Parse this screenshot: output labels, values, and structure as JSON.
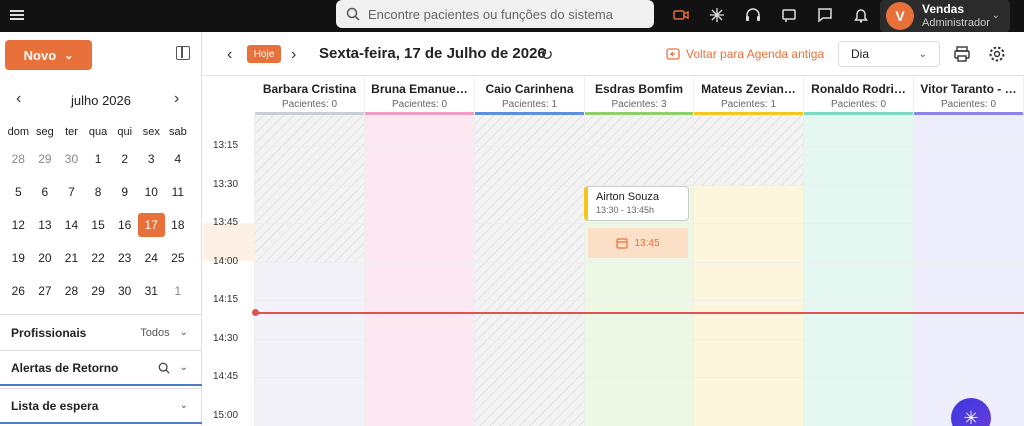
{
  "topbar": {
    "search_placeholder": "Encontre pacientes ou funções do sistema",
    "icons": [
      "video-icon",
      "sparkle-icon",
      "headset-icon",
      "announce-icon",
      "chat-icon",
      "bell-icon"
    ],
    "user": {
      "initial": "V",
      "name": "Vendas",
      "role": "Administrador"
    }
  },
  "sidebar": {
    "new_button": "Novo",
    "calendar": {
      "month_label": "julho 2026",
      "weekdays": [
        "dom",
        "seg",
        "ter",
        "qua",
        "qui",
        "sex",
        "sab"
      ],
      "weeks": [
        [
          "28",
          "29",
          "30",
          "1",
          "2",
          "3",
          "4"
        ],
        [
          "5",
          "6",
          "7",
          "8",
          "9",
          "10",
          "11"
        ],
        [
          "12",
          "13",
          "14",
          "15",
          "16",
          "17",
          "18"
        ],
        [
          "19",
          "20",
          "21",
          "22",
          "23",
          "24",
          "25"
        ],
        [
          "26",
          "27",
          "28",
          "29",
          "30",
          "31",
          "1"
        ]
      ],
      "selected": "17"
    },
    "sections": {
      "profissionais": {
        "label": "Profissionais",
        "value": "Todos"
      },
      "alertas": {
        "label": "Alertas de Retorno"
      },
      "espera": {
        "label": "Lista de espera"
      }
    }
  },
  "toolbar": {
    "today_label": "Hoje",
    "date_label": "Sexta-feira, 17 de Julho de 2026",
    "back_link": "Voltar para Agenda antiga",
    "view_select": "Dia"
  },
  "agenda": {
    "columns": [
      {
        "name": "Barbara Cristina",
        "patients": "Pacientes: 0",
        "color": "#c9cdd4",
        "bg": "hatch"
      },
      {
        "name": "Bruna Emanue…",
        "patients": "Pacientes: 0",
        "color": "#f19cc4",
        "bg": "#fde8f2"
      },
      {
        "name": "Caio Carinhena",
        "patients": "Pacientes: 1",
        "color": "#5b8fe0",
        "bg": "hatch"
      },
      {
        "name": "Esdras Bomfim",
        "patients": "Pacientes: 3",
        "color": "#8fd06a",
        "bg": "#edf8e4"
      },
      {
        "name": "Mateus Zevian…",
        "patients": "Pacientes: 1",
        "color": "#f4c61f",
        "bg": "#fdf5dc"
      },
      {
        "name": "Ronaldo Rodri…",
        "patients": "Pacientes: 0",
        "color": "#7fd9c2",
        "bg": "#e5f7f1"
      },
      {
        "name": "Vitor Taranto - …",
        "patients": "Pacientes: 0",
        "color": "#8b83e8",
        "bg": "#eeedfb"
      }
    ],
    "times": [
      "13:15",
      "13:30",
      "13:45",
      "14:00",
      "14:15",
      "14:30",
      "14:45",
      "15:00"
    ],
    "appointment": {
      "name": "Airton Souza",
      "time": "13:30 - 13:45h"
    },
    "open_slot": "13:45"
  }
}
